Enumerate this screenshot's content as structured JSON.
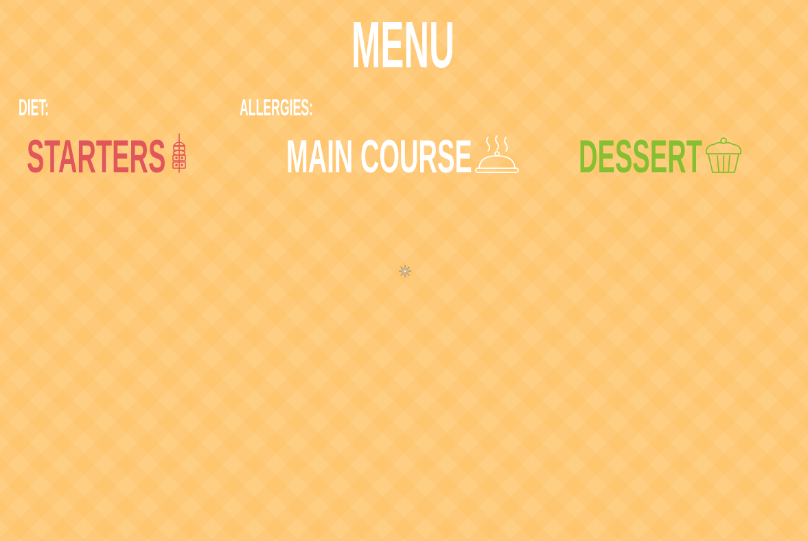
{
  "page": {
    "title": "MENU"
  },
  "filters": {
    "diet_label": "DIET:",
    "allergies_label": "ALLERGIES:"
  },
  "categories": [
    {
      "label": "STARTERS",
      "icon": "kebab-skewer-icon",
      "color": "#e0565b"
    },
    {
      "label": "MAIN COURSE",
      "icon": "serving-cloche-icon",
      "color": "#ffffff"
    },
    {
      "label": "DESSERT",
      "icon": "cupcake-icon",
      "color": "#86bf2f"
    }
  ],
  "colors": {
    "background": "#fec66f",
    "starters": "#e0565b",
    "main_course": "#ffffff",
    "dessert": "#86bf2f"
  },
  "status": {
    "loading_icon": "loading-spinner-icon"
  }
}
